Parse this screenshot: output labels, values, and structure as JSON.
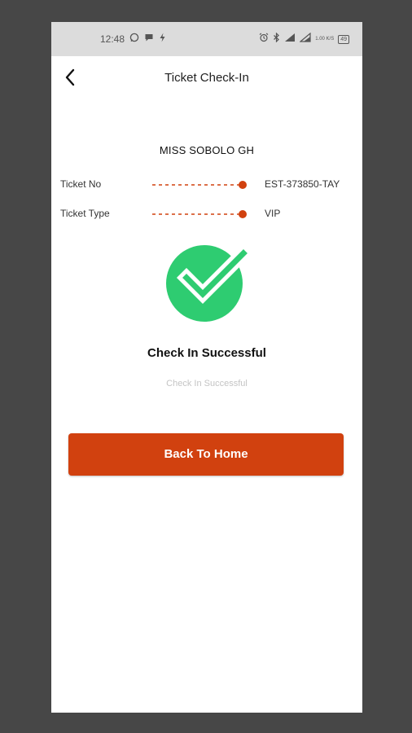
{
  "status_bar": {
    "time": "12:48",
    "left_icons": [
      "whatsapp-icon",
      "chat-icon",
      "flash-icon"
    ],
    "right_icons": [
      "alarm-icon",
      "bluetooth-icon",
      "signal-icon",
      "wifi-signal-icon"
    ],
    "network_speed": "1.00 K/S",
    "battery": "49"
  },
  "header": {
    "title": "Ticket Check-In",
    "back_icon": "chevron-left-icon"
  },
  "event": {
    "name": "MISS SOBOLO GH"
  },
  "ticket_info": [
    {
      "label": "Ticket No",
      "value": "EST-373850-TAY"
    },
    {
      "label": "Ticket Type",
      "value": "VIP"
    }
  ],
  "result": {
    "icon": "check-circle-icon",
    "title": "Check In Successful",
    "subtitle": "Check In Successful"
  },
  "actions": {
    "home_label": "Back To Home"
  },
  "colors": {
    "accent": "#d1410f",
    "success": "#2ecc71",
    "background": "#474747",
    "status_bar": "#dcdcdc"
  }
}
